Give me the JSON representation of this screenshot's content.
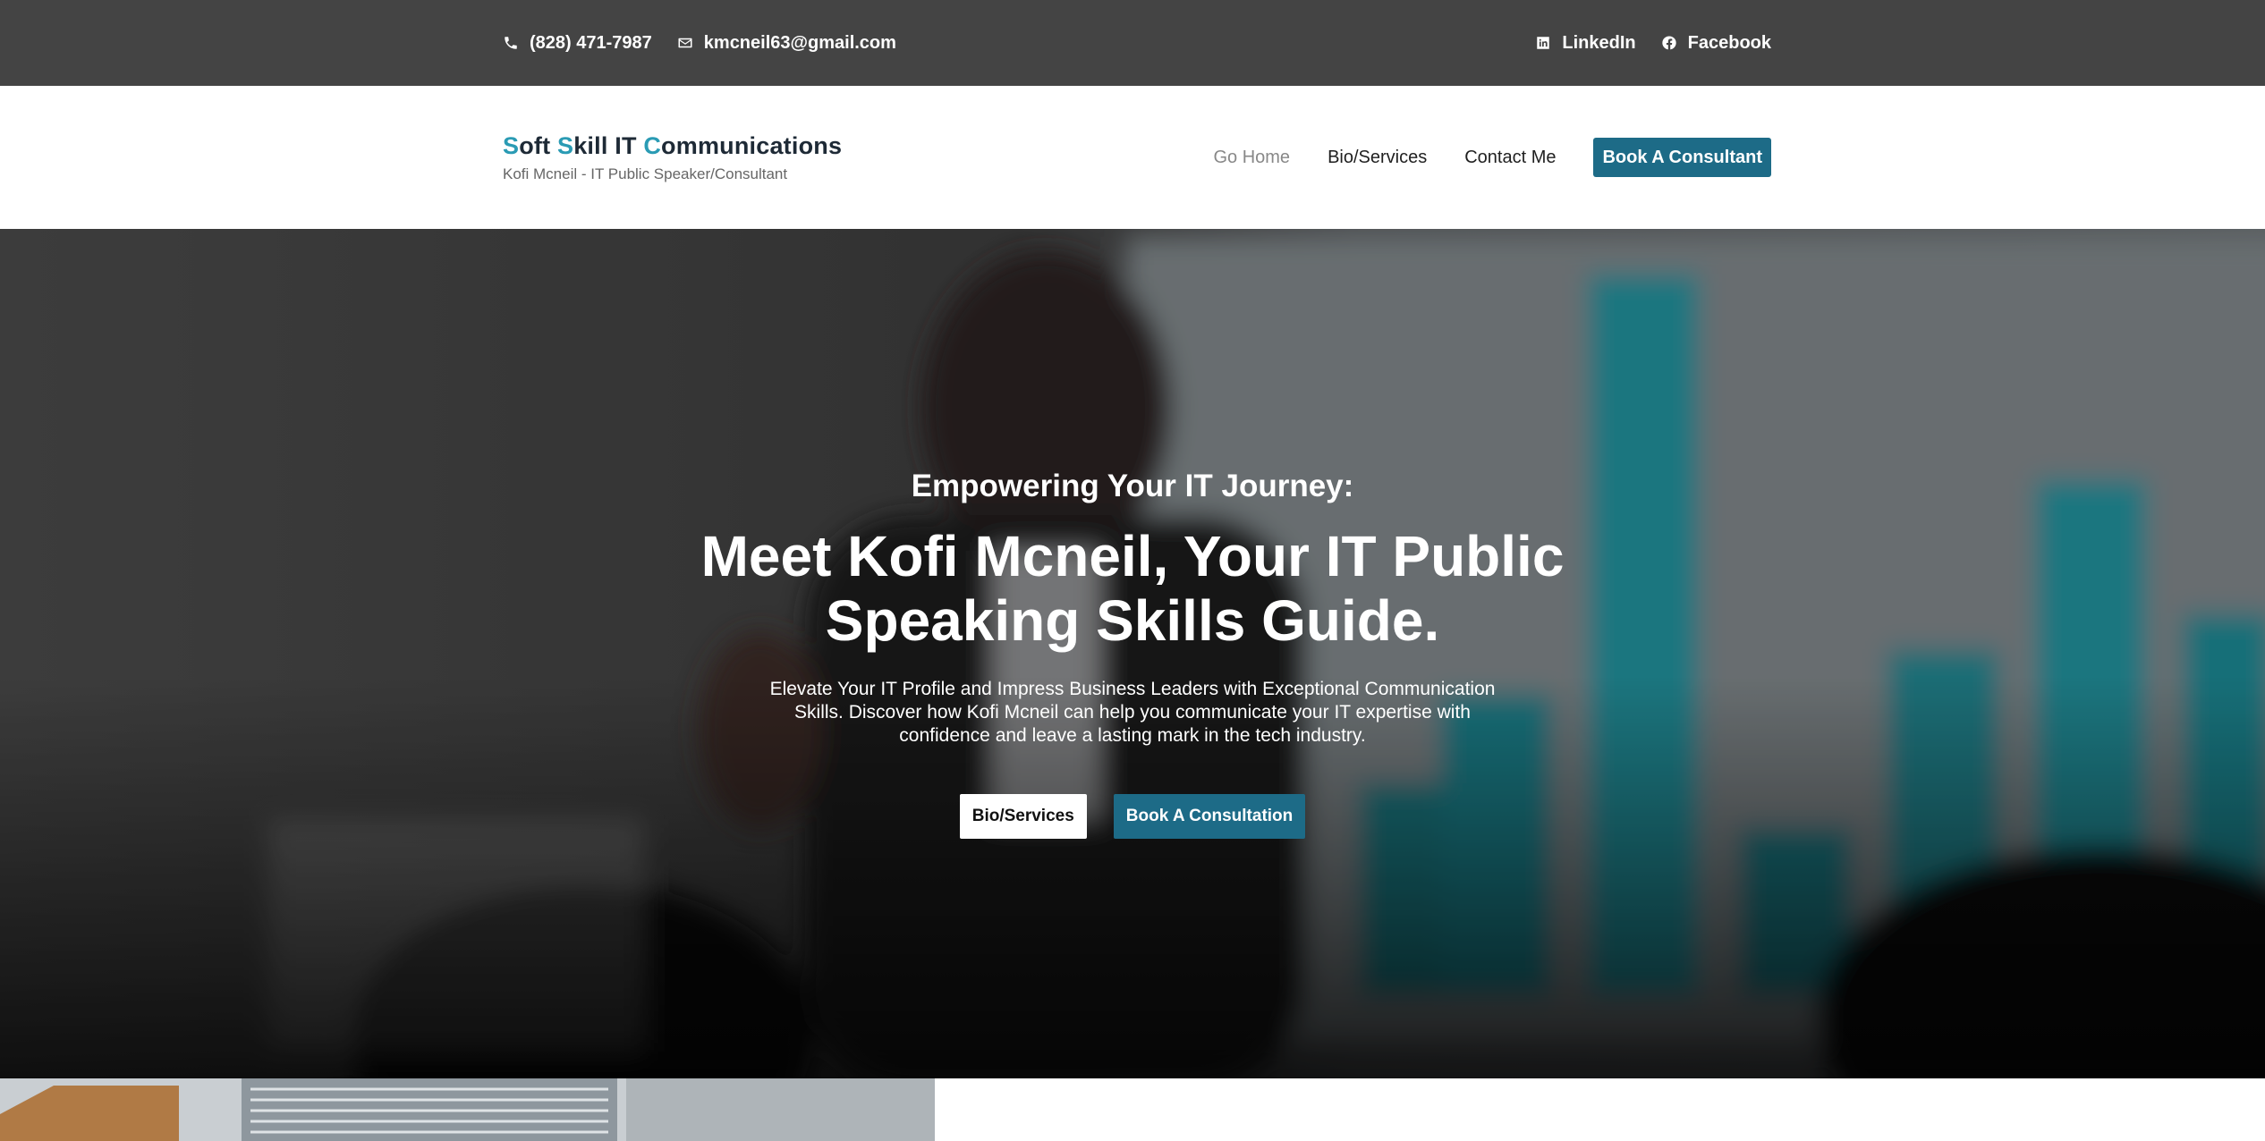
{
  "topbar": {
    "phone": "(828) 471-7987",
    "email": "kmcneil63@gmail.com",
    "linkedin_label": "LinkedIn",
    "facebook_label": "Facebook",
    "icons": [
      "phone-icon",
      "mail-icon",
      "linkedin-icon",
      "facebook-icon"
    ]
  },
  "brand": {
    "title_parts": [
      {
        "text": "S",
        "accent": true
      },
      {
        "text": "oft ",
        "accent": false
      },
      {
        "text": "S",
        "accent": true
      },
      {
        "text": "kill IT ",
        "accent": false
      },
      {
        "text": "C",
        "accent": true
      },
      {
        "text": "ommunications",
        "accent": false
      }
    ],
    "subtitle": "Kofi Mcneil - IT Public Speaker/Consultant"
  },
  "nav": {
    "items": [
      {
        "label": "Go Home",
        "active": true
      },
      {
        "label": "Bio/Services",
        "active": false
      },
      {
        "label": "Contact Me",
        "active": false
      }
    ],
    "cta_label": "Book A Consultant"
  },
  "hero": {
    "eyebrow": "Empowering Your IT Journey:",
    "headline": "Meet Kofi Mcneil, Your IT Public Speaking Skills Guide.",
    "lede": "Elevate Your IT Profile and Impress Business Leaders with Exceptional Communication Skills. Discover how Kofi Mcneil can help you communicate your IT expertise with confidence and leave a lasting mark in the tech industry.",
    "buttons": {
      "primary_label": "Bio/Services",
      "secondary_label": "Book A Consultation"
    }
  },
  "colors": {
    "topbar_bg": "#444444",
    "accent": "#2a9bb4",
    "button_dark": "#1d6b87",
    "text_dark": "#1e2a36"
  }
}
